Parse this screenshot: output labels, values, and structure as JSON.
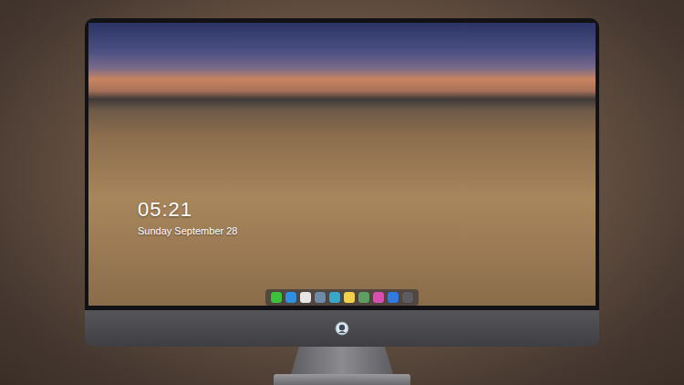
{
  "desktop": {
    "clock": {
      "time": "05:21",
      "date": "Sunday September 28"
    },
    "dock": {
      "items": [
        {
          "color": "#3cc13b"
        },
        {
          "color": "#2f8fe0"
        },
        {
          "color": "#e6e6e6"
        },
        {
          "color": "#6f8aa6"
        },
        {
          "color": "#3aa6c8"
        },
        {
          "color": "#f2d14a"
        },
        {
          "color": "#5f9e62"
        },
        {
          "color": "#d94fb0"
        },
        {
          "color": "#2f7be0"
        },
        {
          "color": "#5c5c60"
        }
      ]
    }
  }
}
